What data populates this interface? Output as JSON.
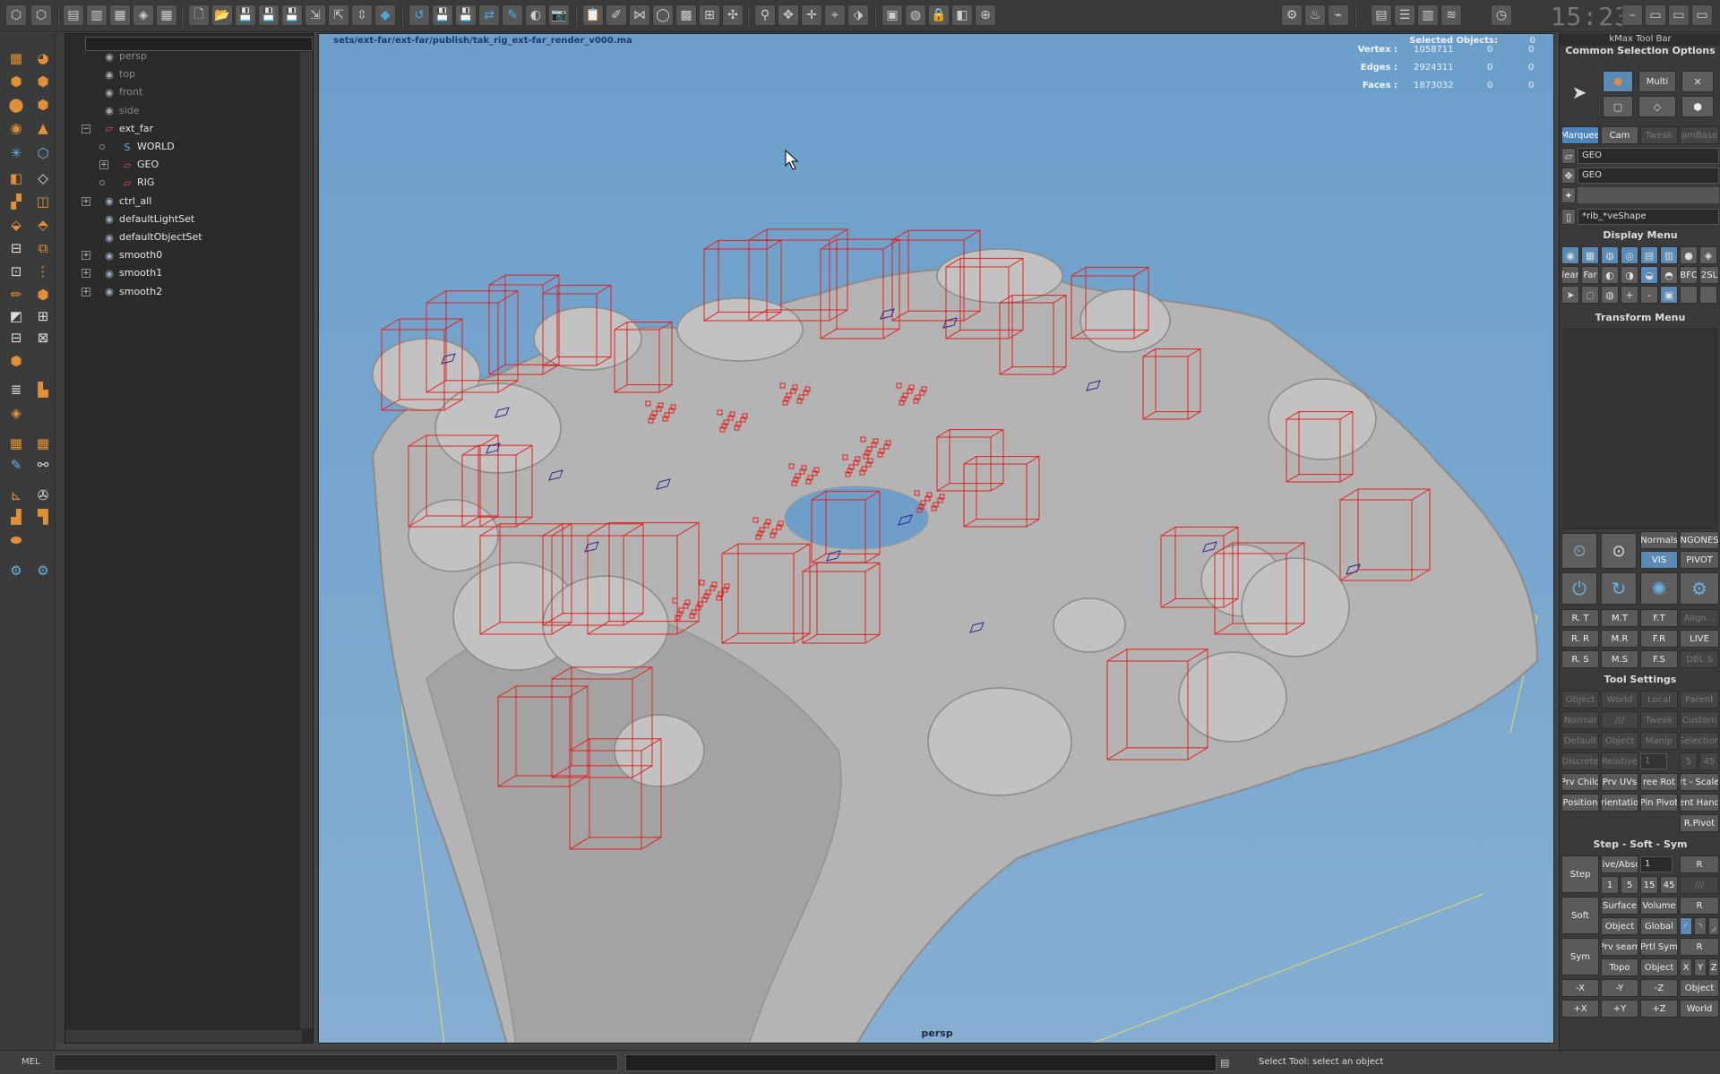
{
  "clock": "15:23",
  "outliner": {
    "items": [
      {
        "label": "persp",
        "dim": true,
        "icon": "camera-icon"
      },
      {
        "label": "top",
        "dim": true,
        "icon": "camera-icon"
      },
      {
        "label": "front",
        "dim": true,
        "icon": "camera-icon"
      },
      {
        "label": "side",
        "dim": true,
        "icon": "camera-icon"
      },
      {
        "label": "ext_far",
        "icon": "transform-icon"
      },
      {
        "label": "WORLD",
        "icon": "curve-icon"
      },
      {
        "label": "GEO",
        "icon": "transform-icon"
      },
      {
        "label": "RIG",
        "icon": "transform-icon"
      },
      {
        "label": "ctrl_all",
        "icon": "set-icon"
      },
      {
        "label": "defaultLightSet",
        "icon": "set-icon"
      },
      {
        "label": "defaultObjectSet",
        "icon": "set-icon"
      },
      {
        "label": "smooth0",
        "icon": "set-icon"
      },
      {
        "label": "smooth1",
        "icon": "set-icon"
      },
      {
        "label": "smooth2",
        "icon": "set-icon"
      }
    ]
  },
  "viewport": {
    "path": "sets/ext-far/ext-far/publish/tak_rig_ext-far_render_v000.ma",
    "selected_title": "Selected Objects:",
    "selected_count": "0",
    "stats": [
      {
        "label": "Vertex :",
        "value": "1058711",
        "z1": "0",
        "z2": "0"
      },
      {
        "label": "Edges :",
        "value": "2924311",
        "z1": "0",
        "z2": "0"
      },
      {
        "label": "Faces :",
        "value": "1873032",
        "z1": "0",
        "z2": "0"
      }
    ],
    "camera": "persp"
  },
  "rightpanel": {
    "title": "kMax Tool Bar",
    "common_selection": "Common Selection Options",
    "multi": "Multi",
    "marquee": "Marquee",
    "cam": "Cam",
    "tweak": "Tweak",
    "cambase": "amBase",
    "geo1": "GEO",
    "geo2": "GEO",
    "shape_field": "*rib_*veShape",
    "display_menu": "Display Menu",
    "near": "lear",
    "far": "Far",
    "bfc": "BFC",
    "twosl": "2SL",
    "transform_menu": "Transform Menu",
    "normals": "Normals",
    "ngones": "NGONES",
    "vis": "VIS",
    "pivot": "PIVOT",
    "rt": "R. T",
    "mt": "M.T",
    "ft": "F.T",
    "align": "Align...",
    "rr": "R. R",
    "mr": "M.R",
    "fr": "F.R",
    "live": "LIVE",
    "rs": "R. S",
    "ms": "M.S",
    "fs": "F.S",
    "dbls": "DBL S",
    "tool_settings": "Tool Settings",
    "ts_object": "Object",
    "ts_world": "World",
    "ts_local": "Local",
    "ts_parent": "Parent",
    "ts_normal": "Normal",
    "ts_slashes": "///",
    "ts_tweak": "Tweak",
    "ts_custom": "Custom",
    "ts_default": "Default",
    "ts_object2": "Object",
    "ts_manip": "Manip",
    "ts_selection": "Selection",
    "ts_discrete": "Discrete",
    "ts_relative": "Relative",
    "ts_one": "1",
    "ts_five": "5",
    "ts_45": "45",
    "ts_prvchild": "Prv Child",
    "ts_prvuvs": "Prv UVs",
    "ts_freerot": "ree Rot",
    "ts_rtscale": "rt - Scale",
    "ts_position": "Position",
    "ts_orient": "rientatio",
    "ts_pinpivot": "Pin Pivot",
    "ts_enthand": "ent Hand",
    "ts_rpivot": "R.Pivot",
    "step_header": "Step - Soft - Sym",
    "step": "Step",
    "stepabs": "tive/Abso",
    "stepval": "1",
    "r": "R",
    "s1": "1",
    "s5": "5",
    "s15": "15",
    "s45": "45",
    "sslash": "///",
    "soft": "Soft",
    "surface": "Surface",
    "volume": "Volume",
    "object": "Object",
    "global": "Global",
    "sym": "Sym",
    "prvseam": "Prv seam",
    "prtlsym": "Prtl Sym",
    "topo": "Topo",
    "object2": "Object",
    "x": "X",
    "y": "Y",
    "z": "Z",
    "nx": "-X",
    "ny": "-Y",
    "nz": "-Z",
    "obj3": "Object",
    "px": "+X",
    "py": "+Y",
    "pz": "+Z",
    "world": "World"
  },
  "statusbar": {
    "mel": "MEL",
    "message": "Select Tool: select an object"
  }
}
